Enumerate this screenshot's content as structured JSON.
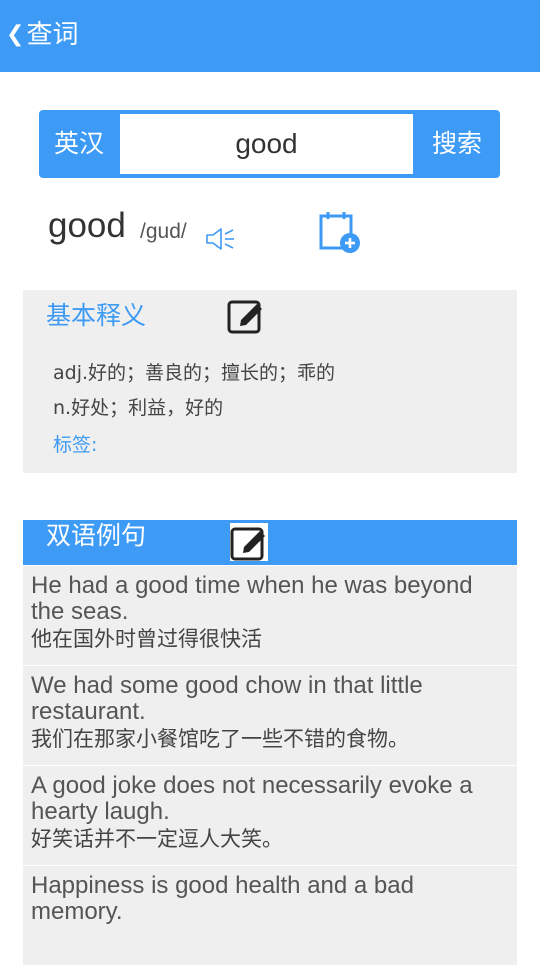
{
  "header": {
    "back_glyph": "❮",
    "title": "查词"
  },
  "search": {
    "mode_label": "英汉",
    "query": "good",
    "button_label": "搜索"
  },
  "entry": {
    "word": "good",
    "phonetic": "/gud/"
  },
  "basic": {
    "heading": "基本释义",
    "definitions": [
      "adj.好的；善良的；擅长的；乖的",
      "n.好处；利益，好的"
    ],
    "tags_label": "标签:"
  },
  "examples": {
    "heading": "双语例句",
    "items": [
      {
        "en": "He had a good time when he was beyond the seas.",
        "zh": "他在国外时曾过得很快活"
      },
      {
        "en": "We had some good chow in that little restaurant.",
        "zh": "我们在那家小餐馆吃了一些不错的食物。"
      },
      {
        "en": "A good joke does not necessarily evoke a hearty laugh.",
        "zh": "好笑话并不一定逗人大笑。"
      },
      {
        "en": "Happiness is good health and a bad memory.",
        "zh": ""
      }
    ]
  },
  "colors": {
    "accent": "#3d9bf5",
    "panel": "#efefef"
  },
  "icons": {
    "speaker": "speaker-icon",
    "add_note": "add-to-notebook-icon",
    "edit": "edit-note-icon"
  }
}
